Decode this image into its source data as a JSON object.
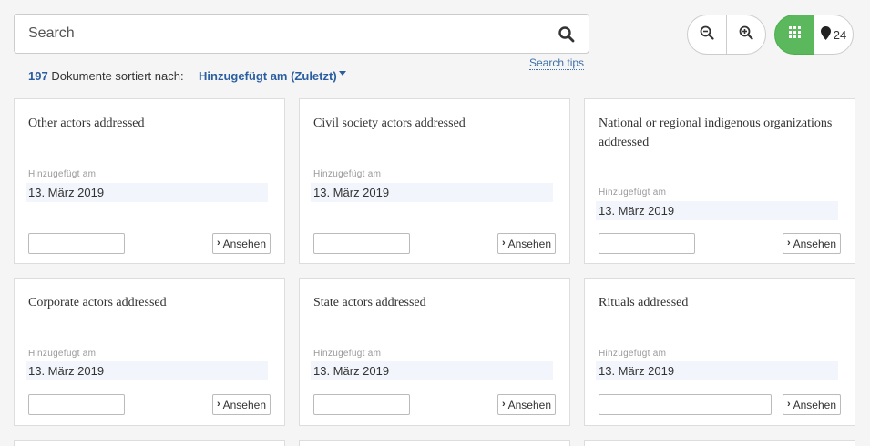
{
  "search": {
    "placeholder": "Search",
    "tips_label": "Search tips"
  },
  "toolbar": {
    "map_count": "24"
  },
  "sort": {
    "count": "197",
    "text": "Dokumente sortiert nach:",
    "label": "Hinzugefügt am (Zuletzt)"
  },
  "cards": [
    {
      "title": "Other actors addressed",
      "meta_label": "Hinzugefügt am",
      "date": "13. März 2019",
      "view_label": "Ansehen"
    },
    {
      "title": "Civil society actors addressed",
      "meta_label": "Hinzugefügt am",
      "date": "13. März 2019",
      "view_label": "Ansehen"
    },
    {
      "title": "National or regional indigenous organizations addressed",
      "meta_label": "Hinzugefügt am",
      "date": "13. März 2019",
      "view_label": "Ansehen"
    },
    {
      "title": "Corporate actors addressed",
      "meta_label": "Hinzugefügt am",
      "date": "13. März 2019",
      "view_label": "Ansehen"
    },
    {
      "title": "State actors addressed",
      "meta_label": "Hinzugefügt am",
      "date": "13. März 2019",
      "view_label": "Ansehen"
    },
    {
      "title": "Rituals addressed",
      "meta_label": "Hinzugefügt am",
      "date": "13. März 2019",
      "view_label": "Ansehen"
    }
  ],
  "icons": {
    "search": "search-icon",
    "zoom_out": "zoom-out-icon",
    "zoom_in": "zoom-in-icon",
    "grid": "grid-icon",
    "map": "map-marker-icon",
    "chevron": "chevron-right-icon"
  },
  "colors": {
    "accent": "#5cb85c",
    "link": "#2a5ea0"
  }
}
